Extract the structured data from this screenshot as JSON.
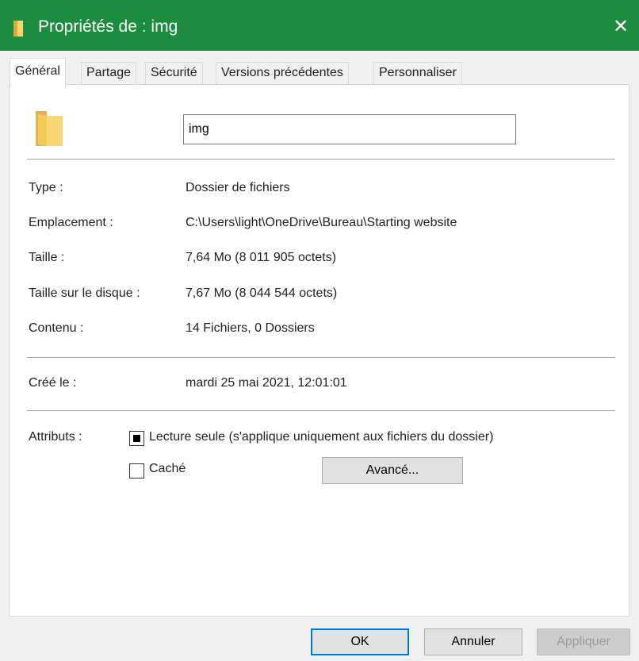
{
  "window": {
    "title": "Propriétés de : img",
    "close_glyph": "✕",
    "accent": "#1e8c3e"
  },
  "tabs": [
    {
      "label": "Général",
      "active": true
    },
    {
      "label": "Partage"
    },
    {
      "label": "Sécurité"
    },
    {
      "label": "Versions précédentes"
    },
    {
      "label": "Personnaliser"
    }
  ],
  "general": {
    "icon": "folder-icon",
    "name_value": "img",
    "info": [
      {
        "label": "Type :",
        "value": "Dossier de fichiers"
      },
      {
        "label": "Emplacement :",
        "value": "C:\\Users\\light\\OneDrive\\Bureau\\Starting website"
      },
      {
        "label": "Taille :",
        "value": "7,64 Mo (8 011 905 octets)"
      },
      {
        "label": "Taille sur le disque :",
        "value": "7,67 Mo (8 044 544 octets)"
      },
      {
        "label": "Contenu :",
        "value": "14 Fichiers, 0 Dossiers"
      }
    ],
    "created": {
      "label": "Créé le :",
      "value": "mardi 25 mai 2021, 12:01:01"
    },
    "attributes": {
      "label": "Attributs :",
      "readonly": {
        "label": "Lecture seule (s'applique uniquement aux fichiers du dossier)",
        "state": "indeterminate"
      },
      "hidden": {
        "label": "Caché",
        "checked": false
      },
      "advanced_button": "Avancé..."
    }
  },
  "footer": {
    "ok": "OK",
    "cancel": "Annuler",
    "apply": "Appliquer"
  }
}
